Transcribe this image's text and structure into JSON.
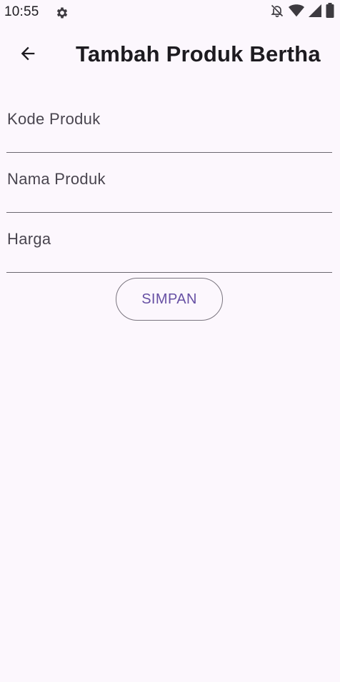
{
  "status_bar": {
    "time": "10:55",
    "icons": [
      "gear-icon",
      "notifications-off-icon",
      "wifi-icon",
      "signal-icon",
      "battery-icon"
    ]
  },
  "app_bar": {
    "back_icon": "arrow-back-icon",
    "title": "Tambah Produk Bertha"
  },
  "form": {
    "fields": [
      {
        "label": "Kode Produk",
        "value": ""
      },
      {
        "label": "Nama Produk",
        "value": ""
      },
      {
        "label": "Harga",
        "value": ""
      }
    ],
    "submit_label": "SIMPAN"
  },
  "colors": {
    "background": "#FCF7FD",
    "primary": "#6750A4",
    "text": "#1D1B20",
    "label": "#49454F",
    "underline": "#6B6770"
  }
}
